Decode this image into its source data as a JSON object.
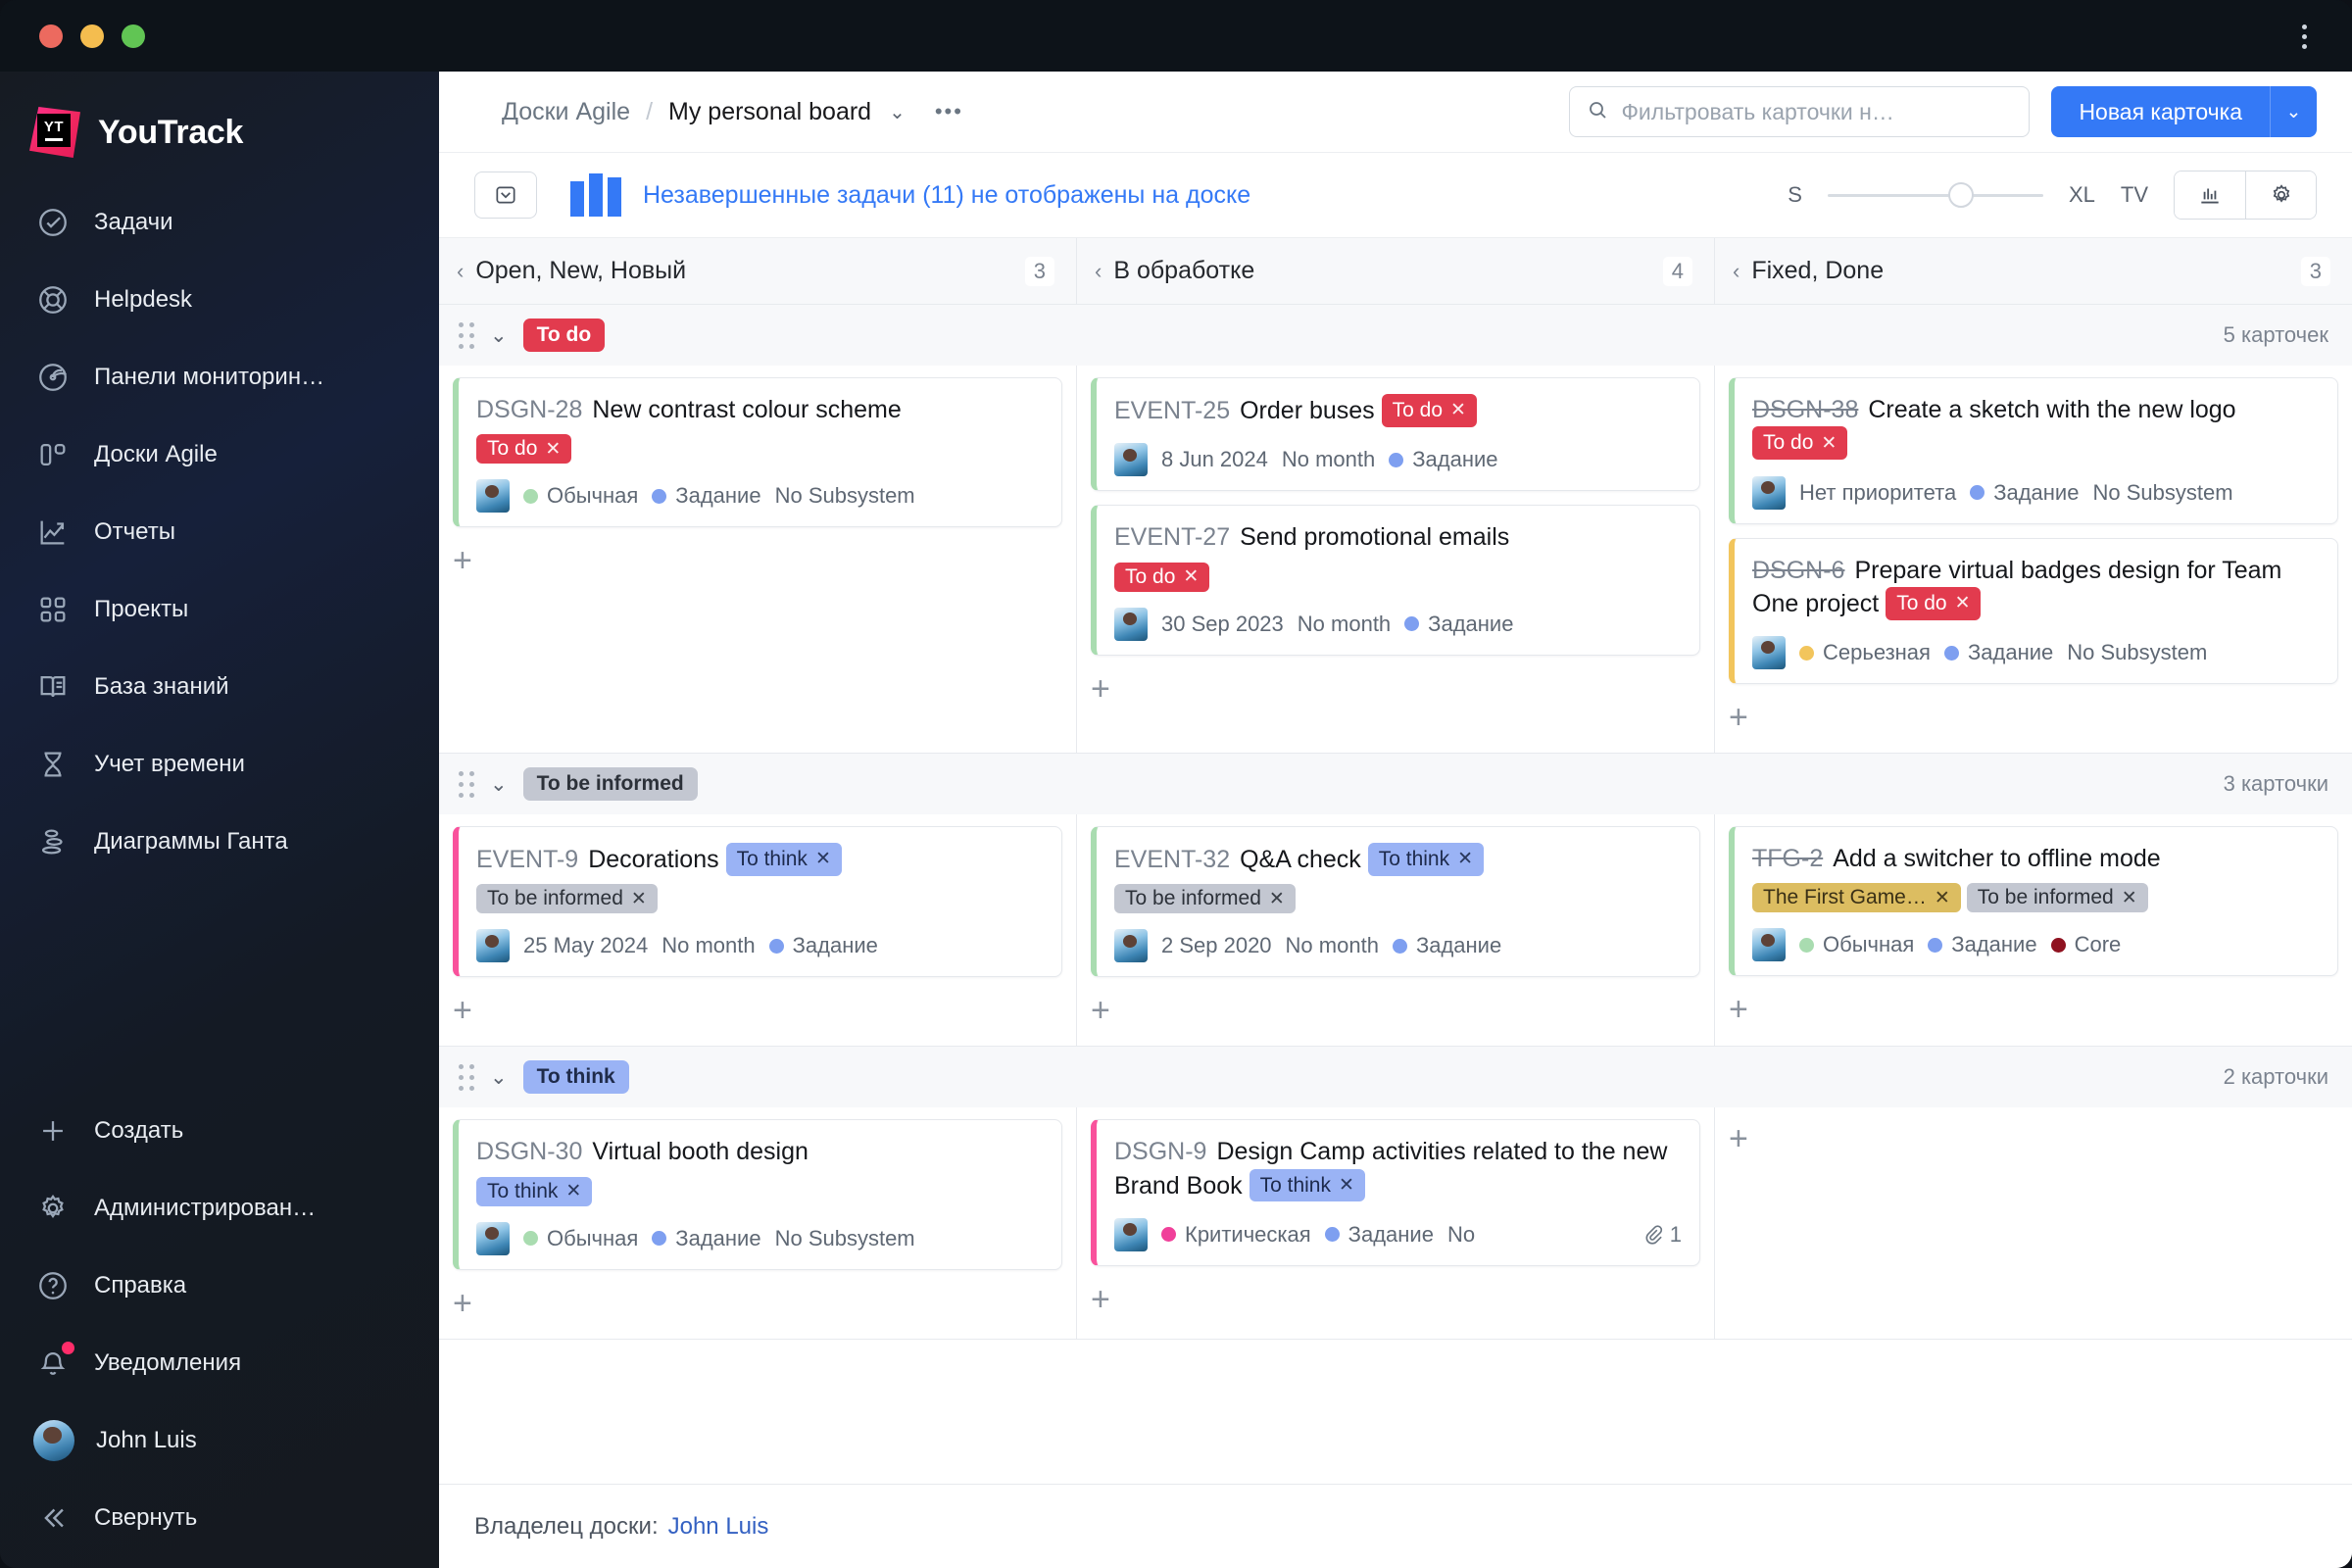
{
  "window": {
    "traffic_lights": [
      "close",
      "minimize",
      "maximize"
    ],
    "kebab_menu": "more-options"
  },
  "sidebar": {
    "brand": "YouTrack",
    "items": [
      {
        "label": "Задачи",
        "icon": "check-circle-icon"
      },
      {
        "label": "Helpdesk",
        "icon": "lifebuoy-icon"
      },
      {
        "label": "Панели мониторин…",
        "icon": "radar-icon"
      },
      {
        "label": "Доски Agile",
        "icon": "board-icon"
      },
      {
        "label": "Отчеты",
        "icon": "chart-line-icon"
      },
      {
        "label": "Проекты",
        "icon": "grid-icon"
      },
      {
        "label": "База знаний",
        "icon": "book-icon"
      },
      {
        "label": "Учет времени",
        "icon": "hourglass-icon"
      },
      {
        "label": "Диаграммы Ганта",
        "icon": "gantt-icon"
      }
    ],
    "bottom_items": [
      {
        "label": "Создать",
        "icon": "plus-icon"
      },
      {
        "label": "Администрирован…",
        "icon": "gear-icon"
      },
      {
        "label": "Справка",
        "icon": "question-circle-icon"
      },
      {
        "label": "Уведомления",
        "icon": "bell-icon",
        "badge": true
      },
      {
        "label": "John Luis",
        "icon": "avatar"
      },
      {
        "label": "Свернуть",
        "icon": "chevrons-left-icon"
      }
    ]
  },
  "header": {
    "breadcrumb_root": "Доски Agile",
    "breadcrumb_separator": "/",
    "breadcrumb_current": "My personal board",
    "dropdown_chevron": "⌄",
    "more_menu": "•••",
    "search_placeholder": "Фильтровать карточки н…",
    "search_value": "",
    "new_card_label": "Новая карточка",
    "new_card_split": "⌄",
    "accent_color": "#3479f6"
  },
  "toolbar": {
    "inbox_button": "archive-icon",
    "chart_glyph": "column-chart-icon",
    "notice": "Незавершенные задачи (11) не отображены на доске",
    "size_min": "S",
    "size_max": "XL",
    "tv_label": "TV",
    "slider_position_percent": 62,
    "chart_button": "bar-chart-icon",
    "settings_button": "gear-icon"
  },
  "columns": [
    {
      "title": "Open, New, Новый",
      "count": "3"
    },
    {
      "title": "В обработке",
      "count": "4"
    },
    {
      "title": "Fixed, Done",
      "count": "3"
    }
  ],
  "swimlanes": [
    {
      "label": "To do",
      "chip_class": "todo",
      "count": "5 карточек",
      "cells": [
        {
          "cards": [
            {
              "id": "DSGN-28",
              "id_struck": false,
              "title": "New contrast colour scheme",
              "accent": "bl-green",
              "inline_tags": [],
              "below_tags": [
                {
                  "label": "To do",
                  "style": "t-todo"
                }
              ],
              "meta": [
                {
                  "type": "dot",
                  "color": "#a9dcb0",
                  "text": "Обычная"
                },
                {
                  "type": "dot",
                  "color": "#7e9ff0",
                  "text": "Задание"
                },
                {
                  "type": "text",
                  "text": "No Subsystem"
                }
              ],
              "attachments": ""
            }
          ]
        },
        {
          "cards": [
            {
              "id": "EVENT-25",
              "id_struck": false,
              "title": "Order buses",
              "accent": "bl-green",
              "inline_tags": [
                {
                  "label": "To do",
                  "style": "t-todo"
                }
              ],
              "below_tags": [],
              "meta": [
                {
                  "type": "text",
                  "text": "8 Jun 2024"
                },
                {
                  "type": "text",
                  "text": "No month"
                },
                {
                  "type": "dot",
                  "color": "#7e9ff0",
                  "text": "Задание"
                }
              ],
              "attachments": ""
            },
            {
              "id": "EVENT-27",
              "id_struck": false,
              "title": "Send promotional emails",
              "accent": "bl-green",
              "inline_tags": [],
              "below_tags": [
                {
                  "label": "To do",
                  "style": "t-todo"
                }
              ],
              "meta": [
                {
                  "type": "text",
                  "text": "30 Sep 2023"
                },
                {
                  "type": "text",
                  "text": "No month"
                },
                {
                  "type": "dot",
                  "color": "#7e9ff0",
                  "text": "Задание"
                }
              ],
              "attachments": ""
            }
          ]
        },
        {
          "cards": [
            {
              "id": "DSGN-38",
              "id_struck": true,
              "title": "Create a sketch with the new logo",
              "accent": "bl-green",
              "inline_tags": [
                {
                  "label": "To do",
                  "style": "t-todo"
                }
              ],
              "below_tags": [],
              "meta": [
                {
                  "type": "text",
                  "text": "Нет приоритета"
                },
                {
                  "type": "dot",
                  "color": "#7e9ff0",
                  "text": "Задание"
                },
                {
                  "type": "text",
                  "text": "No Subsystem"
                }
              ],
              "attachments": ""
            },
            {
              "id": "DSGN-6",
              "id_struck": true,
              "title": "Prepare virtual badges design for Team One project",
              "accent": "bl-yellow",
              "inline_tags": [
                {
                  "label": "To do",
                  "style": "t-todo"
                }
              ],
              "below_tags": [],
              "meta": [
                {
                  "type": "dot",
                  "color": "#f2c55c",
                  "text": "Серьезная"
                },
                {
                  "type": "dot",
                  "color": "#7e9ff0",
                  "text": "Задание"
                },
                {
                  "type": "text",
                  "text": "No Subsystem"
                }
              ],
              "attachments": ""
            }
          ]
        }
      ]
    },
    {
      "label": "To be informed",
      "chip_class": "informed",
      "count": "3 карточки",
      "cells": [
        {
          "cards": [
            {
              "id": "EVENT-9",
              "id_struck": false,
              "title": "Decorations",
              "accent": "bl-pink",
              "inline_tags": [
                {
                  "label": "To think",
                  "style": "t-think"
                }
              ],
              "below_tags": [
                {
                  "label": "To be informed",
                  "style": "t-informed"
                }
              ],
              "meta": [
                {
                  "type": "text",
                  "text": "25 May 2024"
                },
                {
                  "type": "text",
                  "text": "No month"
                },
                {
                  "type": "dot",
                  "color": "#7e9ff0",
                  "text": "Задание"
                }
              ],
              "attachments": ""
            }
          ]
        },
        {
          "cards": [
            {
              "id": "EVENT-32",
              "id_struck": false,
              "title": "Q&A check",
              "accent": "bl-green",
              "inline_tags": [
                {
                  "label": "To think",
                  "style": "t-think"
                }
              ],
              "below_tags": [
                {
                  "label": "To be informed",
                  "style": "t-informed"
                }
              ],
              "meta": [
                {
                  "type": "text",
                  "text": "2 Sep 2020"
                },
                {
                  "type": "text",
                  "text": "No month"
                },
                {
                  "type": "dot",
                  "color": "#7e9ff0",
                  "text": "Задание"
                }
              ],
              "attachments": ""
            }
          ]
        },
        {
          "cards": [
            {
              "id": "TFG-2",
              "id_struck": true,
              "title": "Add a switcher to offline mode",
              "accent": "bl-green",
              "inline_tags": [],
              "below_tags": [
                {
                  "label": "The First Game…",
                  "style": "t-gold"
                },
                {
                  "label": "To be informed",
                  "style": "t-informed"
                }
              ],
              "meta": [
                {
                  "type": "dot",
                  "color": "#a9dcb0",
                  "text": "Обычная"
                },
                {
                  "type": "dot",
                  "color": "#7e9ff0",
                  "text": "Задание"
                },
                {
                  "type": "dot",
                  "color": "#8f1220",
                  "text": "Core"
                }
              ],
              "attachments": ""
            }
          ]
        }
      ]
    },
    {
      "label": "To think",
      "chip_class": "think",
      "count": "2 карточки",
      "cells": [
        {
          "cards": [
            {
              "id": "DSGN-30",
              "id_struck": false,
              "title": "Virtual booth design",
              "accent": "bl-green",
              "inline_tags": [],
              "below_tags": [
                {
                  "label": "To think",
                  "style": "t-think"
                }
              ],
              "meta": [
                {
                  "type": "dot",
                  "color": "#a9dcb0",
                  "text": "Обычная"
                },
                {
                  "type": "dot",
                  "color": "#7e9ff0",
                  "text": "Задание"
                },
                {
                  "type": "text",
                  "text": "No Subsystem"
                }
              ],
              "attachments": ""
            }
          ]
        },
        {
          "cards": [
            {
              "id": "DSGN-9",
              "id_struck": false,
              "title": "Design Camp activities related to the new Brand Book",
              "accent": "bl-pink",
              "inline_tags": [
                {
                  "label": "To think",
                  "style": "t-think"
                }
              ],
              "below_tags": [],
              "meta": [
                {
                  "type": "dot",
                  "color": "#f0409a",
                  "text": "Критическая"
                },
                {
                  "type": "dot",
                  "color": "#7e9ff0",
                  "text": "Задание"
                },
                {
                  "type": "text",
                  "text": "No"
                }
              ],
              "attachments": "1"
            }
          ]
        },
        {
          "cards": []
        }
      ]
    }
  ],
  "footer": {
    "owner_label": "Владелец доски:",
    "owner_name": "John Luis"
  },
  "add_card_glyph": "+"
}
